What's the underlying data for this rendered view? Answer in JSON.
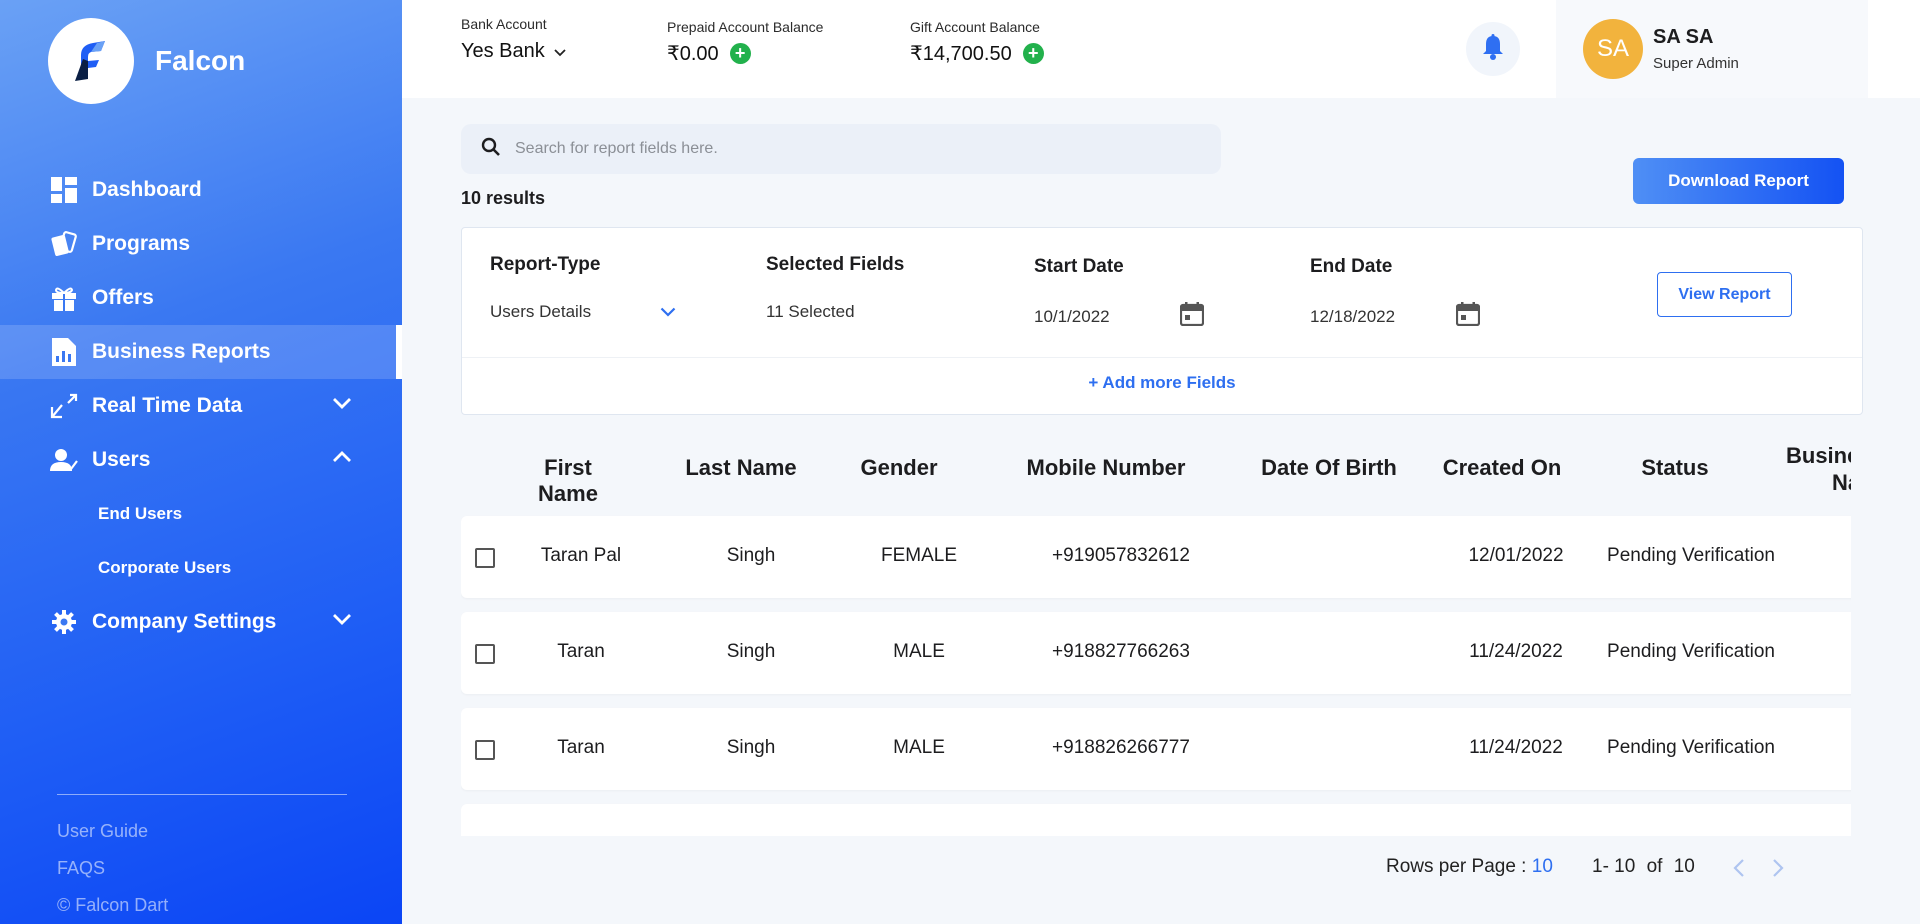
{
  "brand": {
    "name": "Falcon"
  },
  "nav": {
    "items": [
      {
        "label": "Dashboard",
        "icon": "dashboard-icon"
      },
      {
        "label": "Programs",
        "icon": "programs-icon"
      },
      {
        "label": "Offers",
        "icon": "gift-icon"
      },
      {
        "label": "Business Reports",
        "icon": "report-icon",
        "active": true
      },
      {
        "label": "Real Time Data",
        "icon": "realtime-icon",
        "expanded": false
      },
      {
        "label": "Users",
        "icon": "users-icon",
        "expanded": true
      },
      {
        "label": "Company Settings",
        "icon": "gear-icon",
        "expanded": false
      }
    ],
    "users_sub": [
      "End Users",
      "Corporate Users"
    ]
  },
  "sidebar_footer": {
    "user_guide": "User Guide",
    "faqs": "FAQS",
    "copyright": "© Falcon Dart"
  },
  "topbar": {
    "bank_label": "Bank Account",
    "bank_value": "Yes Bank",
    "prepaid_label": "Prepaid Account Balance",
    "prepaid_value": "₹0.00",
    "gift_label": "Gift Account Balance",
    "gift_value": "₹14,700.50",
    "profile": {
      "initials": "SA",
      "name": "SA SA",
      "role": "Super Admin"
    }
  },
  "search": {
    "placeholder": "Search for report fields here."
  },
  "results_text": "10 results",
  "download_label": "Download Report",
  "filters": {
    "report_type_label": "Report-Type",
    "report_type_value": "Users Details",
    "selected_fields_label": "Selected Fields",
    "selected_fields_value": "11 Selected",
    "start_date_label": "Start Date",
    "start_date_value": "10/1/2022",
    "end_date_label": "End Date",
    "end_date_value": "12/18/2022",
    "view_report_label": "View Report",
    "add_more_label": "+ Add more Fields"
  },
  "table": {
    "headers": [
      "First Name",
      "Last Name",
      "Gender",
      "Mobile Number",
      "Date Of Birth",
      "Created On",
      "Status",
      "Busine",
      "Na"
    ],
    "rows": [
      [
        "Taran Pal",
        "Singh",
        "FEMALE",
        "+919057832612",
        "",
        "12/01/2022",
        "Pending Verification"
      ],
      [
        "Taran",
        "Singh",
        "MALE",
        "+918827766263",
        "",
        "11/24/2022",
        "Pending Verification"
      ],
      [
        "Taran",
        "Singh",
        "MALE",
        "+918826266777",
        "",
        "11/24/2022",
        "Pending Verification"
      ]
    ]
  },
  "pagination": {
    "rows_label": "Rows per Page :",
    "rows_value": "10",
    "range": "1- 10",
    "of": "of",
    "total": "10"
  },
  "colors": {
    "accent": "#2e6ff0",
    "sidebar_start": "#6aa1f5",
    "sidebar_end": "#0b45f5",
    "avatar": "#f2b33d",
    "plus": "#22b14c"
  }
}
